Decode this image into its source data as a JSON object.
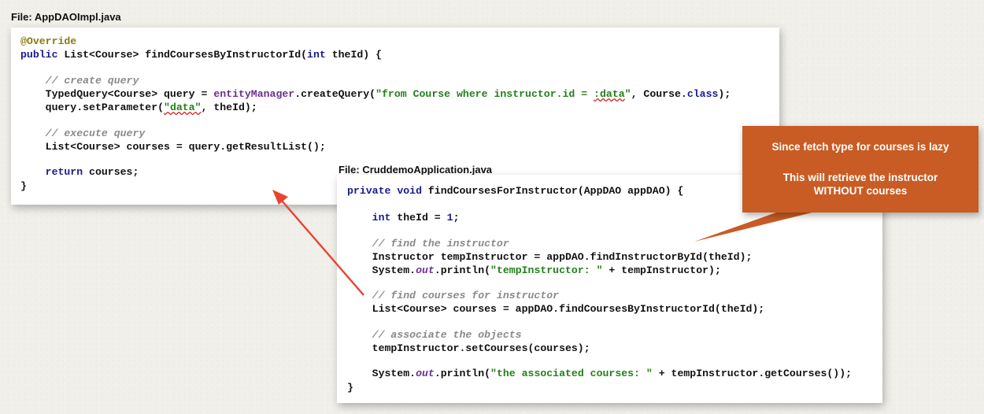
{
  "file1": {
    "label": "File: AppDAOImpl.java",
    "lines": {
      "l1": "@Override",
      "l2a": "public",
      "l2b": " List<Course> findCoursesByInstructorId(",
      "l2c": "int",
      "l2d": " theId) {",
      "l3": "    // create query",
      "l4a": "    TypedQuery<Course> query = ",
      "l4b": "entityManager",
      "l4c": ".createQuery(",
      "l4d": "\"from Course where instructor.id = ",
      "l4e": ":data",
      "l4f": "\"",
      "l4g": ", Course.",
      "l4h": "class",
      "l4i": ");",
      "l5a": "    query.setParameter(",
      "l5b": "\"data\"",
      "l5c": ", theId);",
      "l6": "    // execute query",
      "l7": "    List<Course> courses = query.getResultList();",
      "l8a": "    ",
      "l8b": "return",
      "l8c": " courses;",
      "l9": "}"
    }
  },
  "file2": {
    "label": "File: CruddemoApplication.java",
    "lines": {
      "m1a": "private",
      "m1b": " ",
      "m1c": "void",
      "m1d": " findCoursesForInstructor(AppDAO appDAO) {",
      "m2a": "    ",
      "m2b": "int",
      "m2c": " theId = ",
      "m2d": "1",
      "m2e": ";",
      "m3": "    // find the instructor",
      "m4": "    Instructor tempInstructor = appDAO.findInstructorById(theId);",
      "m5a": "    System.",
      "m5b": "out",
      "m5c": ".println(",
      "m5d": "\"tempInstructor: \"",
      "m5e": " + tempInstructor);",
      "m6": "    // find courses for instructor",
      "m7": "    List<Course> courses = appDAO.findCoursesByInstructorId(theId);",
      "m8": "    // associate the objects",
      "m9": "    tempInstructor.setCourses(courses);",
      "m10a": "    System.",
      "m10b": "out",
      "m10c": ".println(",
      "m10d": "\"the associated courses: \"",
      "m10e": " + tempInstructor.getCourses());",
      "m11": "}"
    }
  },
  "callout": {
    "line1": "Since fetch type for courses is lazy",
    "line2": "This will retrieve the instructor",
    "line3": "WITHOUT courses",
    "color": "#c85c24"
  },
  "arrow_color": "#e8432e"
}
